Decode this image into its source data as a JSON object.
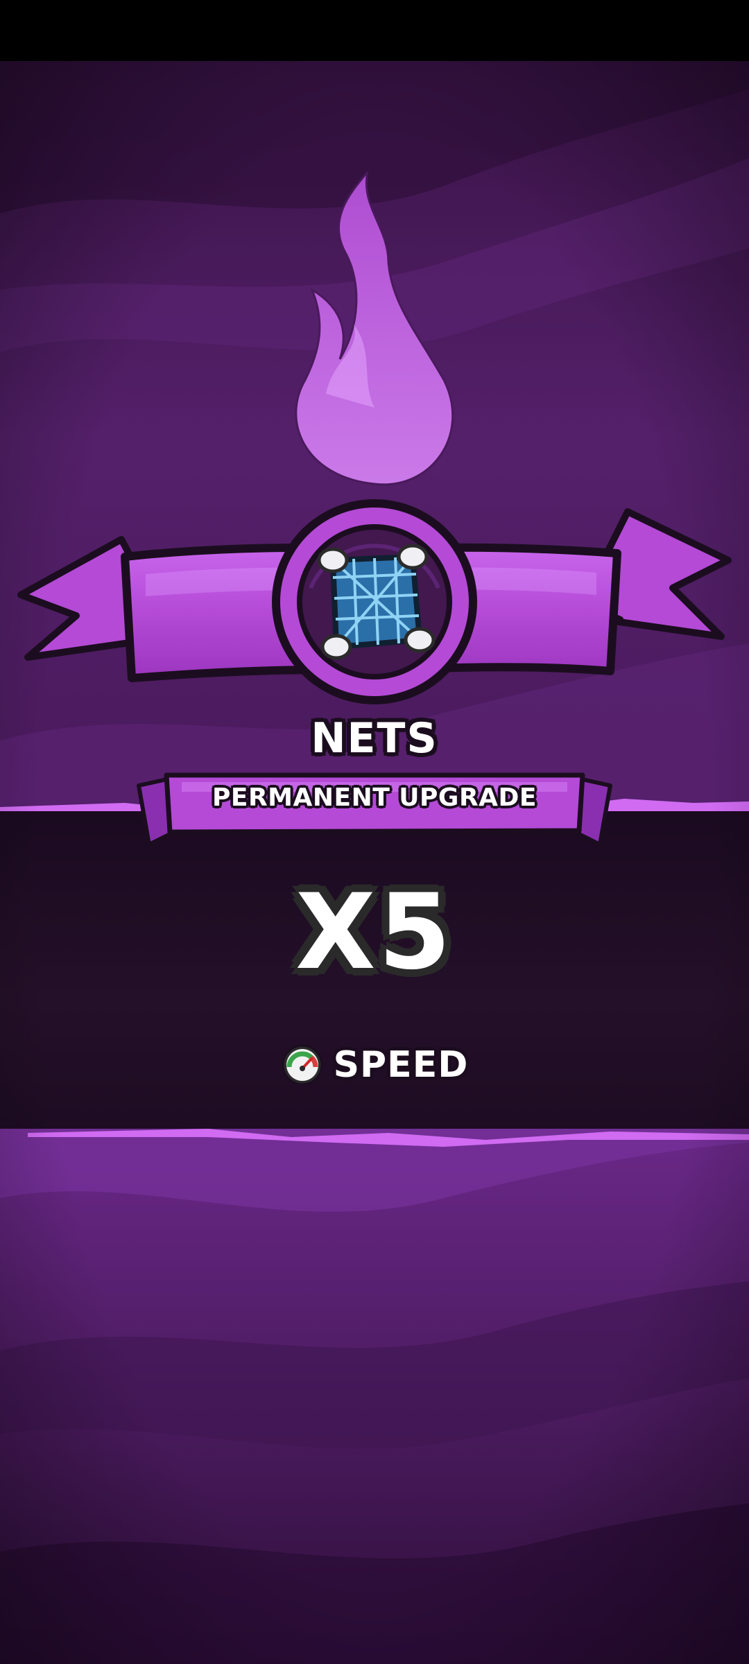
{
  "reward": {
    "item_name": "NETS",
    "item_icon": "fishing-net-icon",
    "upgrade_type": "PERMANENT UPGRADE",
    "multiplier": "X5",
    "stat_icon": "speedometer-icon",
    "stat_label": "SPEED"
  },
  "colors": {
    "accent": "#b44ad6",
    "background": "#4a1a5c",
    "band": "#1c0b22"
  }
}
